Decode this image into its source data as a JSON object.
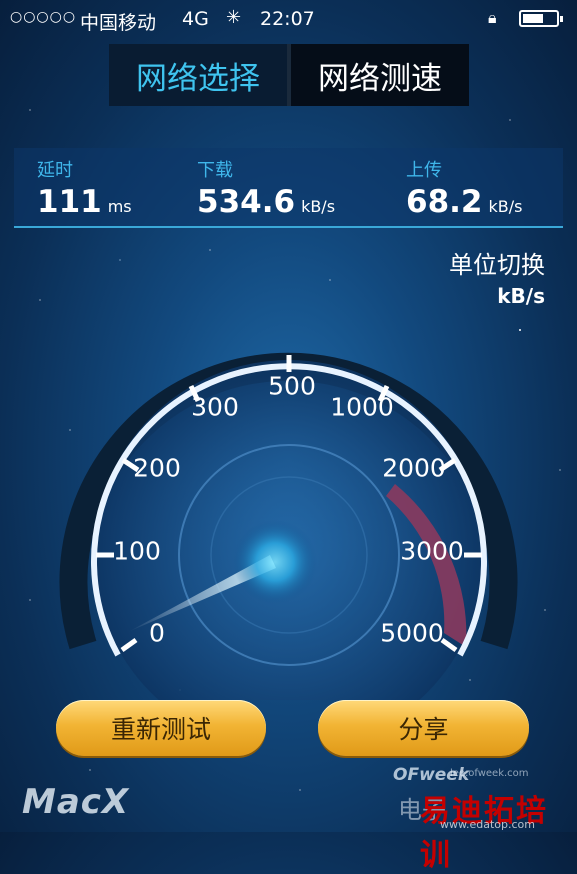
{
  "statusbar": {
    "signal": "○○○○○",
    "carrier": "中国移动",
    "network": "4G",
    "time": "22:07",
    "battery_percent": 50
  },
  "tabs": [
    {
      "label": "网络选择",
      "active": true
    },
    {
      "label": "网络测速",
      "active": false
    }
  ],
  "stats": {
    "latency": {
      "label": "延时",
      "value": "111",
      "unit": "ms"
    },
    "download": {
      "label": "下载",
      "value": "534.6",
      "unit": "kB/s"
    },
    "upload": {
      "label": "上传",
      "value": "68.2",
      "unit": "kB/s"
    }
  },
  "unit_switch": {
    "title": "单位切换",
    "unit": "kB/s"
  },
  "gauge": {
    "labels": [
      "0",
      "100",
      "200",
      "300",
      "500",
      "1000",
      "2000",
      "3000",
      "5000"
    ],
    "needle_value_label": "100",
    "needle_fraction_between_0_and_100": 0.6,
    "accent_color": "#8a3a5e"
  },
  "buttons": {
    "retest": "重新测试",
    "share": "分享"
  },
  "watermarks": {
    "macx": "MacX",
    "ofweek": "OFweek",
    "ofweek_url": "lee.ofweek.com",
    "dianzi": "电子",
    "yidi": "易迪拓培训",
    "yidi_url": "www.edatop.com"
  }
}
